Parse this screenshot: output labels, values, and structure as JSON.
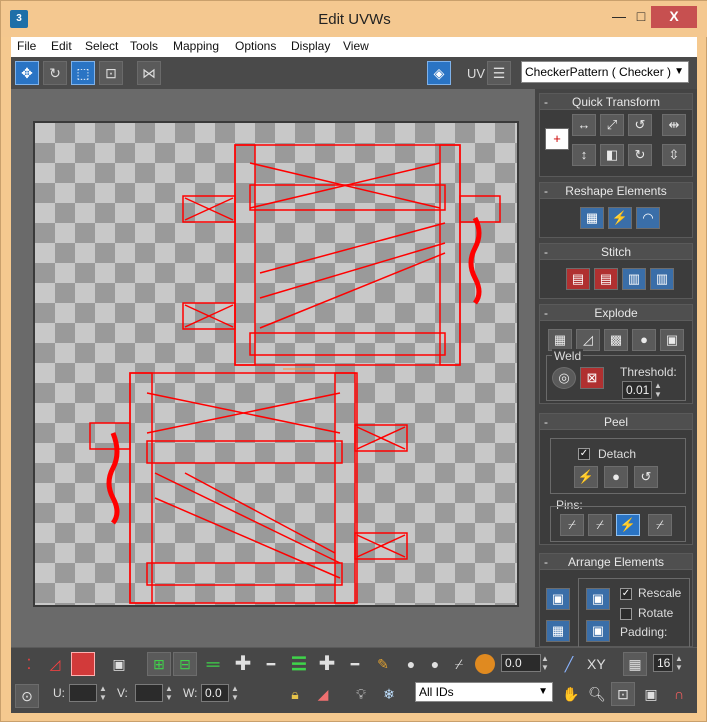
{
  "window": {
    "title": "Edit UVWs",
    "app_icon": "3ds-max-icon",
    "close_glyph": "X",
    "minimize_glyph": "—",
    "maximize_glyph": "□"
  },
  "menu": [
    "File",
    "Edit",
    "Select",
    "Tools",
    "Mapping",
    "Options",
    "Display",
    "View"
  ],
  "toolbar": {
    "uv_label": "UV",
    "checker_select": "CheckerPattern  ( Checker )",
    "icons": [
      "move-icon",
      "rotate-icon",
      "scale-icon",
      "freeform-icon",
      "mirror-icon",
      "checker-display-icon",
      "list-icon"
    ]
  },
  "quick_transform": {
    "title": "Quick Transform"
  },
  "reshape": {
    "title": "Reshape Elements"
  },
  "stitch": {
    "title": "Stitch"
  },
  "explode": {
    "title": "Explode",
    "weld_label": "Weld",
    "threshold_label": "Threshold:",
    "threshold_value": "0.01"
  },
  "peel": {
    "title": "Peel",
    "detach_label": "Detach",
    "detach_checked": true,
    "pins_label": "Pins:"
  },
  "arrange": {
    "title": "Arrange Elements",
    "rescale_label": "Rescale",
    "rescale_checked": true,
    "rotate_label": "Rotate",
    "rotate_checked": false,
    "padding_label": "Padding:"
  },
  "bottom": {
    "weight_value": "0.0",
    "xy_label": "XY",
    "grid_value": "16",
    "u_label": "U:",
    "v_label": "V:",
    "w_label": "W:",
    "w_value": "0.0",
    "ids_select": "All IDs"
  },
  "colors": {
    "wireframe": "#ff0000",
    "accent": "#2a74c4",
    "panel": "#444444",
    "close": "#c75050"
  }
}
